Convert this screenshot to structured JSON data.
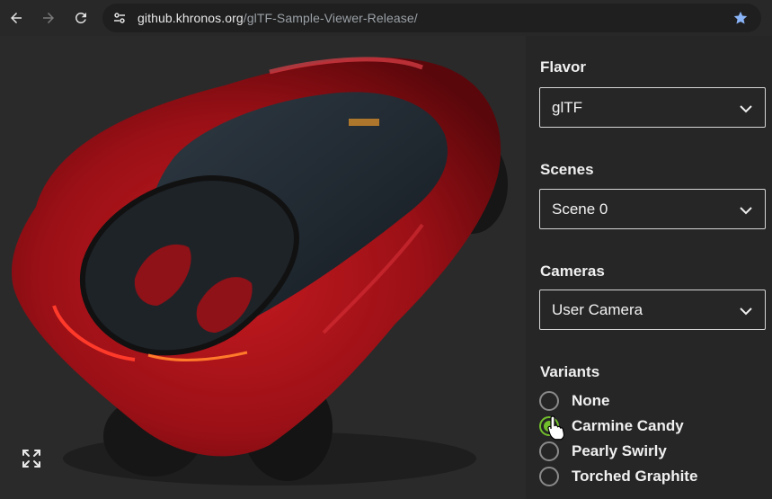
{
  "browser": {
    "back_icon": "arrow-left-icon",
    "forward_icon": "arrow-right-icon",
    "reload_icon": "reload-icon",
    "site_info_icon": "tune-icon",
    "url_host": "github.khronos.org",
    "url_path": "/glTF-Sample-Viewer-Release/",
    "bookmark_icon": "star-icon",
    "bookmark_color": "#8ab4f8"
  },
  "viewport": {
    "fullscreen_icon": "expand-icon",
    "car_color": "#b0141a"
  },
  "panel": {
    "flavor": {
      "label": "Flavor",
      "value": "glTF"
    },
    "scenes": {
      "label": "Scenes",
      "value": "Scene 0"
    },
    "cameras": {
      "label": "Cameras",
      "value": "User Camera"
    },
    "variants": {
      "label": "Variants",
      "options": [
        {
          "label": "None",
          "checked": false
        },
        {
          "label": "Carmine Candy",
          "checked": true
        },
        {
          "label": "Pearly Swirly",
          "checked": false
        },
        {
          "label": "Torched Graphite",
          "checked": false
        }
      ]
    },
    "accent_color": "#72c02c"
  }
}
